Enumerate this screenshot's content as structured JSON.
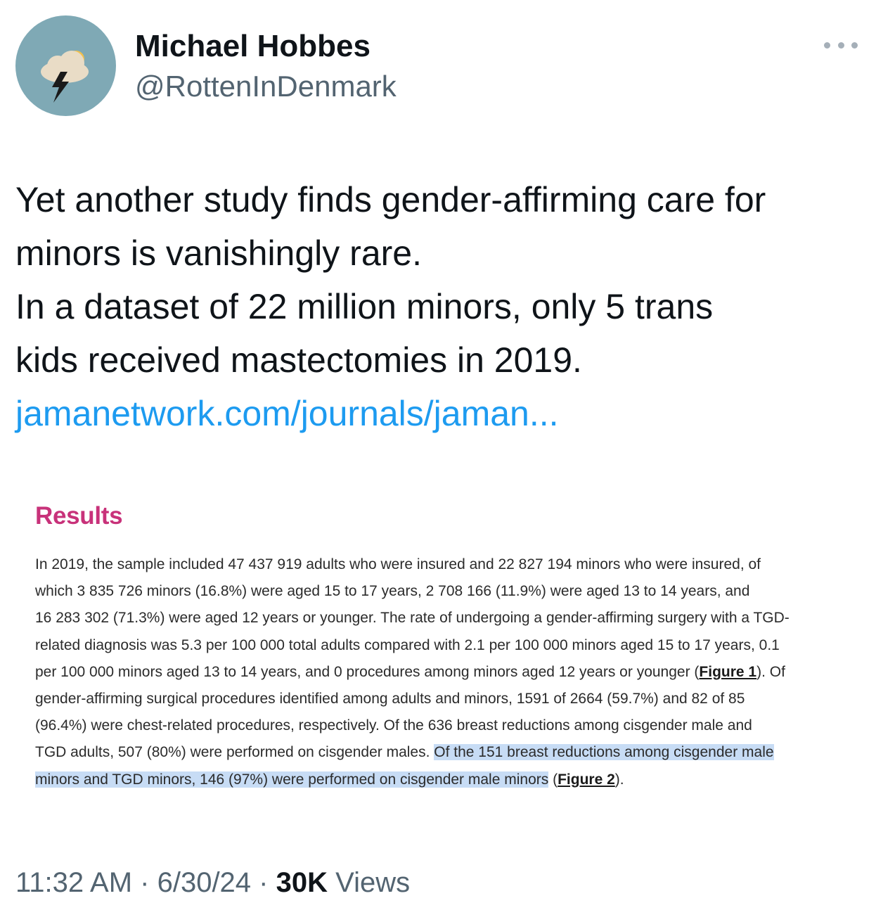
{
  "author": {
    "name": "Michael Hobbes",
    "handle": "@RottenInDenmark",
    "avatar_icon": "storm-cloud-icon"
  },
  "more_icon": "more-dots-icon",
  "tweet": {
    "lines": [
      "Yet another study finds gender-affirming care for",
      "minors is vanishingly rare.",
      "In a dataset of 22 million minors, only 5 trans",
      "kids received mastectomies in 2019."
    ],
    "link": "jamanetwork.com/journals/jaman..."
  },
  "embed": {
    "title": "Results",
    "lines": [
      "In 2019, the sample included 47 437 919 adults who were insured and 22 827 194 minors who were insured, of",
      "which 3 835 726 minors (16.8%) were aged 15 to 17 years, 2 708 166 (11.9%) were aged 13 to 14 years, and",
      "16 283 302 (71.3%) were aged 12 years or younger. The rate of undergoing a gender-affirming surgery with a TGD-",
      "related diagnosis was 5.3 per 100 000 total adults compared with 2.1 per 100 000 minors aged 15 to 17 years, 0.1",
      "gender-affirming surgical procedures identified among adults and minors, 1591 of 2664 (59.7%) and 82 of 85",
      "(96.4%) were chest-related procedures, respectively. Of the 636 breast reductions among cisgender male and"
    ],
    "line5_pre": "per 100 000 minors aged 13 to 14 years, and 0 procedures among minors aged 12 years or younger (",
    "figure1": "Figure 1",
    "line5_post": "). Of",
    "line8_pre": "TGD adults, 507 (80%) were performed on cisgender males. ",
    "line8_highlight": "Of the 151 breast reductions among cisgender male",
    "line9_highlight": "minors and TGD minors, 146 (97%) were performed on cisgender male minors",
    "line9_open": " (",
    "figure2": "Figure 2",
    "line9_post": ")."
  },
  "footer": {
    "time": "11:32 AM",
    "sep1": " · ",
    "date": "6/30/24",
    "sep2": " · ",
    "views_count": "30K",
    "views_label": " Views"
  },
  "colors": {
    "link": "#1d9bf0",
    "results_title": "#c8327a",
    "highlight": "#c7dcf5",
    "avatar_bg": "#7fa9b5"
  }
}
